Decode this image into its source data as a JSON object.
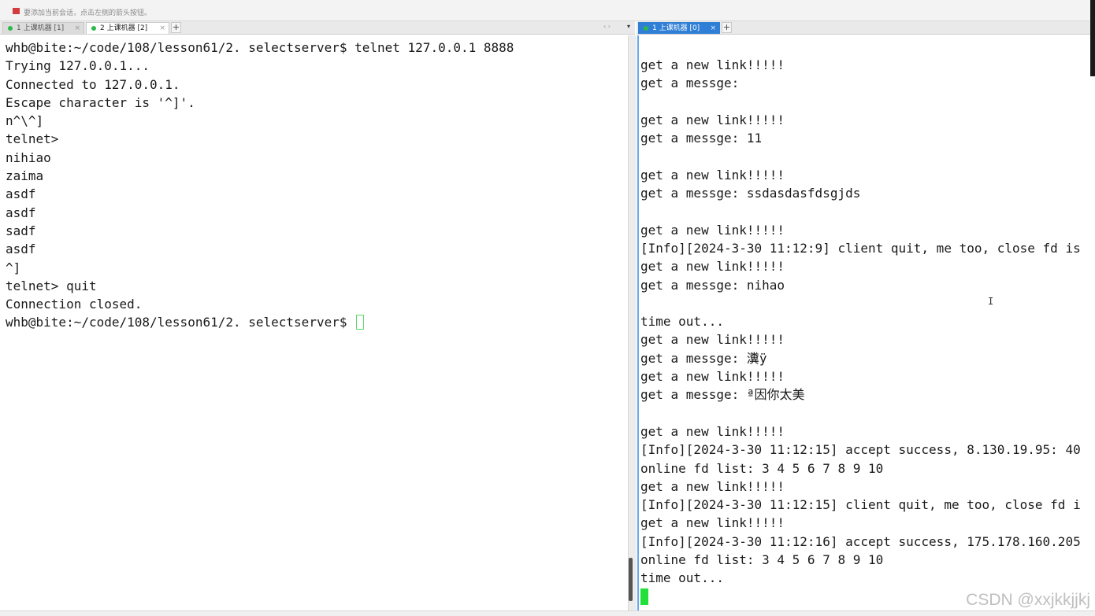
{
  "hint": {
    "text": "要添加当前会话，点击左侧的箭头按钮。"
  },
  "left_tabs": [
    {
      "label": "1 上课机器 [1]",
      "close": "×"
    },
    {
      "label": "2 上课机器 [2]",
      "close": "×"
    }
  ],
  "left_tabbar": {
    "plus": "+",
    "nav": "‹ ›",
    "menu": "▾"
  },
  "right_tabs": [
    {
      "label": "1 上课机器 [0]",
      "close": "×"
    }
  ],
  "right_tabbar": {
    "plus": "+"
  },
  "left_terminal": {
    "lines": [
      "whb@bite:~/code/108/lesson61/2. selectserver$ telnet 127.0.0.1 8888",
      "Trying 127.0.0.1...",
      "Connected to 127.0.0.1.",
      "Escape character is '^]'.",
      "n^\\^]",
      "telnet>",
      "nihiao",
      "zaima",
      "asdf",
      "asdf",
      "sadf",
      "asdf",
      "^]",
      "telnet> quit",
      "Connection closed."
    ],
    "prompt": "whb@bite:~/code/108/lesson61/2. selectserver$ "
  },
  "right_terminal": {
    "lines": [
      "get a new link!!!!!",
      "get a messge:",
      "",
      "get a new link!!!!!",
      "get a messge: 11",
      "",
      "get a new link!!!!!",
      "get a messge: ssdasdasfdsgjds",
      "",
      "get a new link!!!!!",
      "[Info][2024-3-30 11:12:9] client quit, me too, close fd is",
      "get a new link!!!!!",
      "get a messge: nihao",
      "",
      "time out...",
      "get a new link!!!!!",
      "get a messge: 瀵ÿ",
      "get a new link!!!!!",
      "get a messge: ª因你太美",
      "",
      "get a new link!!!!!",
      "[Info][2024-3-30 11:12:15] accept success, 8.130.19.95: 40",
      "online fd list: 3 4 5 6 7 8 9 10",
      "get a new link!!!!!",
      "[Info][2024-3-30 11:12:15] client quit, me too, close fd i",
      "get a new link!!!!!",
      "[Info][2024-3-30 11:12:16] accept success, 175.178.160.205",
      "online fd list: 3 4 5 6 7 8 9 10",
      "time out..."
    ]
  },
  "watermark": "CSDN @xxjkkjjkj",
  "ibeam": "I",
  "colors": {
    "active_tab": "#2f7fd6",
    "status_dot": "#2db84a",
    "cursor": "#22e03a"
  }
}
